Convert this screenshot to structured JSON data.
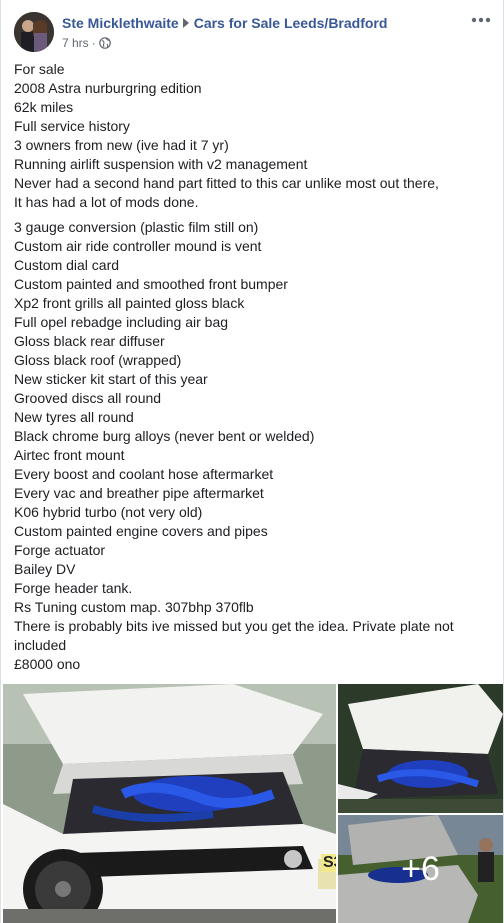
{
  "post": {
    "author": "Ste Micklethwaite",
    "group": "Cars for Sale Leeds/Bradford",
    "time": "7 hrs",
    "dot": "·",
    "privacy_icon": "globe-icon",
    "more_icon": "more-options-icon"
  },
  "text": {
    "intro": [
      "For sale",
      "2008 Astra nurburgring edition",
      "62k miles",
      "Full service history",
      "3 owners from new (ive had it 7 yr)",
      "Running airlift suspension with v2 management",
      "Never had a second hand part fitted to this car unlike most out there,",
      "It has had a lot of mods done."
    ],
    "mods": [
      "3 gauge conversion (plastic film still on)",
      "Custom air ride controller mound is vent",
      "Custom dial card",
      "Custom painted and smoothed front bumper",
      "Xp2 front grills all painted gloss black",
      "Full opel rebadge including air bag",
      "Gloss black rear diffuser",
      "Gloss black roof (wrapped)",
      "New sticker kit start of this year",
      "Grooved discs all round",
      "New tyres all round",
      "Black chrome burg alloys (never bent or welded)",
      "Airtec front mount",
      "Every boost and coolant hose aftermarket",
      "Every vac and breather pipe aftermarket",
      "K06 hybrid turbo (not very old)",
      "Custom painted engine covers and pipes",
      "Forge actuator",
      "Bailey DV",
      "Forge header tank.",
      "Rs Tuning custom map. 307bhp 370flb",
      "There is probably bits ive missed but you get the idea. Private plate not included",
      "£8000 ono"
    ]
  },
  "photos": {
    "more_count": "+6",
    "plate_fragment": "S3"
  },
  "colors": {
    "link": "#385898",
    "meta": "#606770",
    "text": "#1c1e21"
  }
}
